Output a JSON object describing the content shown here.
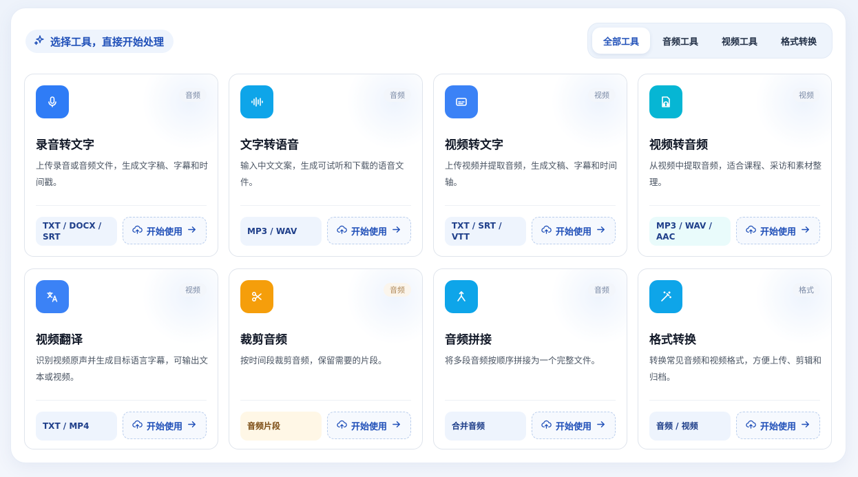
{
  "header": {
    "title": "选择工具，直接开始处理",
    "icon": "sparkle-icon"
  },
  "tabs": [
    {
      "label": "全部工具",
      "active": true
    },
    {
      "label": "音频工具",
      "active": false
    },
    {
      "label": "视频工具",
      "active": false
    },
    {
      "label": "格式转换",
      "active": false
    }
  ],
  "start_label": "开始使用",
  "cards": [
    {
      "title": "录音转文字",
      "tag": "音频",
      "desc": "上传录音或音频文件，生成文字稿、字幕和时间戳。",
      "format": "TXT / DOCX / SRT",
      "icon": "microphone-icon",
      "icon_color": "#2f7cf6",
      "format_bg": "#eef4fd",
      "format_color": "#1f3f8a"
    },
    {
      "title": "文字转语音",
      "tag": "音频",
      "desc": "输入中文文案，生成可试听和下载的语音文件。",
      "format": "MP3 / WAV",
      "icon": "waveform-icon",
      "icon_color": "#0ea5e9",
      "format_bg": "#eef4fd",
      "format_color": "#1f3f8a"
    },
    {
      "title": "视频转文字",
      "tag": "视频",
      "desc": "上传视频并提取音频，生成文稿、字幕和时间轴。",
      "format": "TXT / SRT / VTT",
      "icon": "subtitles-icon",
      "icon_color": "#3b82f6",
      "format_bg": "#eef4fd",
      "format_color": "#1f3f8a"
    },
    {
      "title": "视频转音频",
      "tag": "视频",
      "desc": "从视频中提取音频，适合课程、采访和素材整理。",
      "format": "MP3 / WAV / AAC",
      "icon": "audio-file-icon",
      "icon_color": "#06b6d4",
      "format_bg": "#e9fbfb",
      "format_color": "#1f3f8a"
    },
    {
      "title": "视频翻译",
      "tag": "视频",
      "desc": "识别视频原声并生成目标语言字幕，可输出文本或视频。",
      "format": "TXT / MP4",
      "icon": "translate-icon",
      "icon_color": "#3b82f6",
      "format_bg": "#eef4fd",
      "format_color": "#1f3f8a"
    },
    {
      "title": "裁剪音频",
      "tag": "音频",
      "desc": "按时间段裁剪音频，保留需要的片段。",
      "format": "音频片段",
      "icon": "scissors-icon",
      "icon_color": "#f59e0b",
      "format_bg": "#fff7e6",
      "format_color": "#7a4b12"
    },
    {
      "title": "音频拼接",
      "tag": "音频",
      "desc": "将多段音频按顺序拼接为一个完整文件。",
      "format": "合并音频",
      "icon": "merge-icon",
      "icon_color": "#0ea5e9",
      "format_bg": "#eef4fd",
      "format_color": "#1f3f8a"
    },
    {
      "title": "格式转换",
      "tag": "格式",
      "desc": "转换常见音频和视频格式，方便上传、剪辑和归档。",
      "format": "音频 / 视频",
      "icon": "magic-wand-icon",
      "icon_color": "#0ea5e9",
      "format_bg": "#eef4fd",
      "format_color": "#1f3f8a"
    }
  ]
}
